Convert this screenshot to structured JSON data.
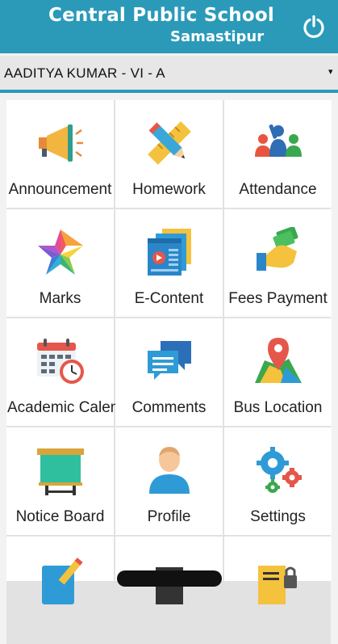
{
  "header": {
    "school_name": "Central Public School",
    "school_city": "Samastipur",
    "power_icon": "power-icon"
  },
  "student_selector": {
    "value": "AADITYA KUMAR - VI - A",
    "arrow": "▾"
  },
  "tiles": [
    {
      "label": "Announcement",
      "icon": "megaphone-icon"
    },
    {
      "label": "Homework",
      "icon": "pencil-ruler-icon"
    },
    {
      "label": "Attendance",
      "icon": "people-icon"
    },
    {
      "label": "Marks",
      "icon": "star-icon"
    },
    {
      "label": "E-Content",
      "icon": "video-screens-icon"
    },
    {
      "label": "Fees Payment",
      "icon": "hand-money-icon"
    },
    {
      "label": "Academic Calendar",
      "icon": "calendar-clock-icon"
    },
    {
      "label": "Comments",
      "icon": "chat-bubbles-icon"
    },
    {
      "label": "Bus Location",
      "icon": "map-pin-icon"
    },
    {
      "label": "Notice Board",
      "icon": "board-icon"
    },
    {
      "label": "Profile",
      "icon": "person-icon"
    },
    {
      "label": "Settings",
      "icon": "gears-icon"
    }
  ],
  "colors": {
    "header": "#2b9ab9",
    "selector_bg": "#e7e7e7",
    "tile_bg": "#ffffff"
  }
}
